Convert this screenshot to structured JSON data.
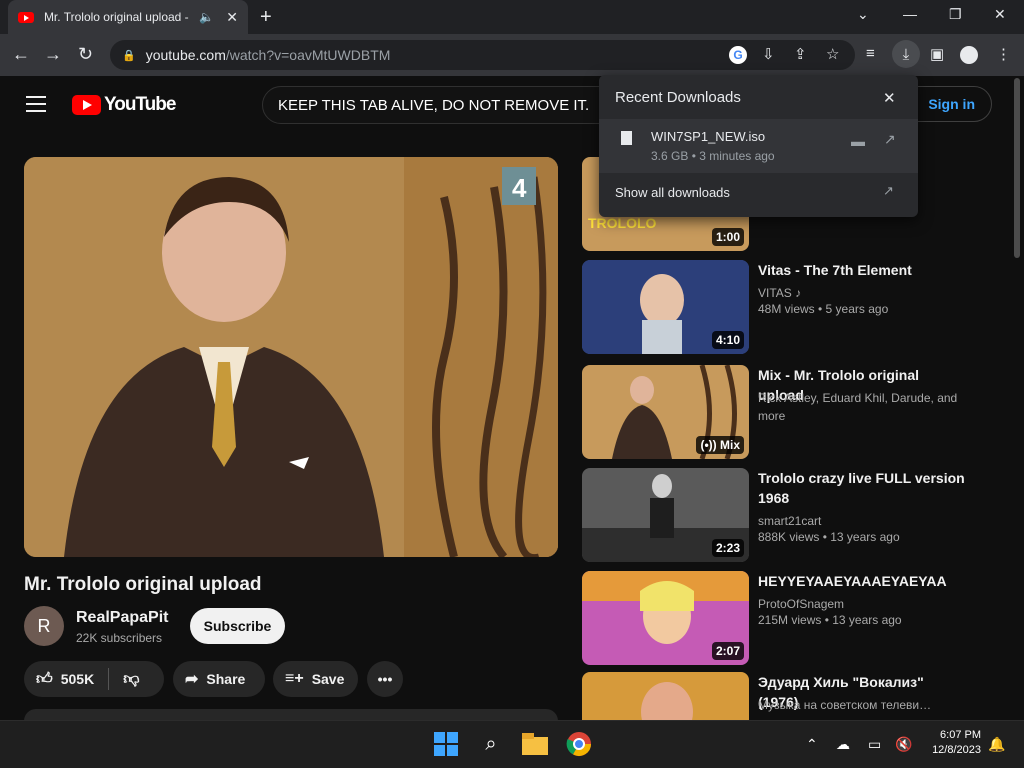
{
  "browser": {
    "tab": {
      "title": "Mr. Trololo original upload -",
      "audio_icon": "speaker-icon",
      "close_icon": "close-icon"
    },
    "new_tab_icon": "plus-icon",
    "window_controls": [
      "chevron-down-icon",
      "minimize-icon",
      "restore-icon",
      "close-icon"
    ],
    "address": {
      "host": "youtube.com",
      "path": "/watch?v=oavMtUWDBTM"
    },
    "toolbar_icons": [
      "google-icon",
      "install-icon",
      "share-icon",
      "bookmark-star-icon",
      "reading-list-icon",
      "download-icon",
      "side-panel-icon",
      "profile-icon",
      "kebab-menu-icon"
    ]
  },
  "youtube": {
    "logo_text": "YouTube",
    "search_value": "KEEP THIS TAB ALIVE,  DO NOT REMOVE IT.",
    "signin_label": "Sign in",
    "video": {
      "title": "Mr. Trololo original upload",
      "channel_initial": "R",
      "channel": "RealPapaPit",
      "subscribers": "22K subscribers",
      "subscribe_label": "Subscribe",
      "likes": "505K",
      "share_label": "Share",
      "save_label": "Save",
      "overlay_badge": "4"
    },
    "top_thumb": {
      "text": "TROLOLO",
      "duration": "1:00"
    },
    "recommendations": [
      {
        "title": "Vitas - The 7th Element",
        "channel": "VITAS ♪",
        "meta": "48M views  • 5 years ago",
        "duration": "4:10",
        "color": "#6a87c8"
      },
      {
        "title": "Mix - Mr. Trololo original upload",
        "channel": "Rick Astley, Eduard Khil, Darude, and more",
        "meta": "",
        "duration": "(•)) Mix",
        "color": "#c79a5c"
      },
      {
        "title": "Trololo crazy live FULL version 1968",
        "channel": "smart21cart",
        "meta": "888K views  • 13 years ago",
        "duration": "2:23",
        "color": "#6b6b6b"
      },
      {
        "title": "HEYYEYAAEYAAAEYAEYAA",
        "channel": "ProtoOfSnagem",
        "meta": "215M views  • 13 years ago",
        "duration": "2:07",
        "color": "#c86ab8"
      },
      {
        "title": "Эдуард Хиль \"Вокализ\" (1976)",
        "channel": "Музыка на советском телеви…",
        "meta": "",
        "duration": "",
        "color": "#d69a3b"
      }
    ]
  },
  "downloads_popup": {
    "header": "Recent Downloads",
    "file_name": "WIN7SP1_NEW.iso",
    "file_meta": "3.6 GB • 3 minutes ago",
    "show_all": "Show all downloads"
  },
  "taskbar": {
    "time": "6:07 PM",
    "date": "12/8/2023",
    "apps": [
      "windows-start-icon",
      "search-icon",
      "file-explorer-icon",
      "chrome-icon"
    ]
  }
}
